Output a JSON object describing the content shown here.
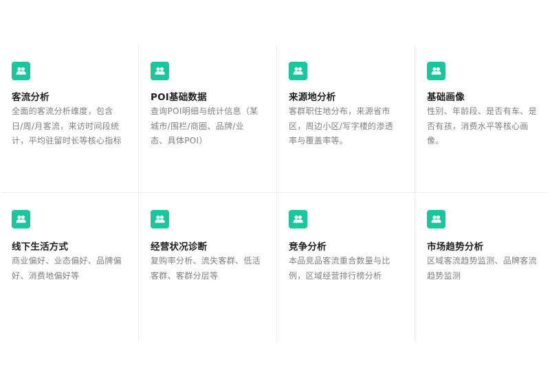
{
  "accent_color": "#19c79d",
  "features": [
    {
      "icon": "users-icon",
      "title": "客流分析",
      "desc": "全面的客流分析维度，包含日/周/月客流，来访时间段统计，平均驻留时长等核心指标"
    },
    {
      "icon": "users-icon",
      "title": "POI基础数据",
      "desc": "查询POI明细与统计信息（某城市/围栏/商圈、品牌/业态、具体POI）"
    },
    {
      "icon": "users-icon",
      "title": "来源地分析",
      "desc": "客群职住地分布，来源省市区，周边小区/写字楼的渗透率与覆盖率等。"
    },
    {
      "icon": "users-icon",
      "title": "基础画像",
      "desc": "性别、年龄段、是否有车、是否有孩，消费水平等核心画像。"
    },
    {
      "icon": "users-icon",
      "title": "线下生活方式",
      "desc": "商业偏好、业态偏好、品牌偏好、消费地偏好等"
    },
    {
      "icon": "users-icon",
      "title": "经营状况诊断",
      "desc": "复购率分析、流失客群、低活客群、客群分层等"
    },
    {
      "icon": "users-icon",
      "title": "竞争分析",
      "desc": "本品竞品客流重合数量与比例，区域经营排行榜分析"
    },
    {
      "icon": "users-icon",
      "title": "市场趋势分析",
      "desc": "区域客流趋势监测、品牌客流趋势监测"
    }
  ]
}
